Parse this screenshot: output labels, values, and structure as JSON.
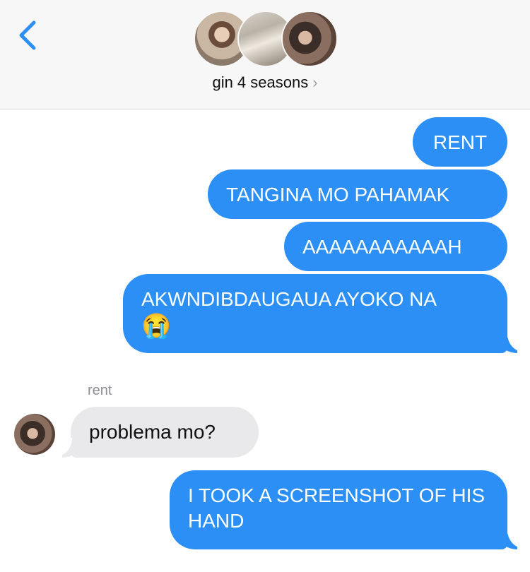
{
  "header": {
    "group_name": "gin 4 seasons",
    "chevron": "›",
    "back_icon": "chevron-left-icon",
    "accent_color": "#2c8ff5"
  },
  "messages": [
    {
      "direction": "outgoing",
      "text": "RENT"
    },
    {
      "direction": "outgoing",
      "text": "TANGINA MO PAHAMAK"
    },
    {
      "direction": "outgoing",
      "text": "AAAAAAAAAAAH"
    },
    {
      "direction": "outgoing",
      "text": "AKWNDIBDAUGAUA AYOKO NA",
      "emoji": "😭"
    },
    {
      "direction": "incoming",
      "sender": "rent",
      "text": "problema mo?"
    },
    {
      "direction": "outgoing",
      "text": "I TOOK A SCREENSHOT OF HIS HAND"
    }
  ]
}
